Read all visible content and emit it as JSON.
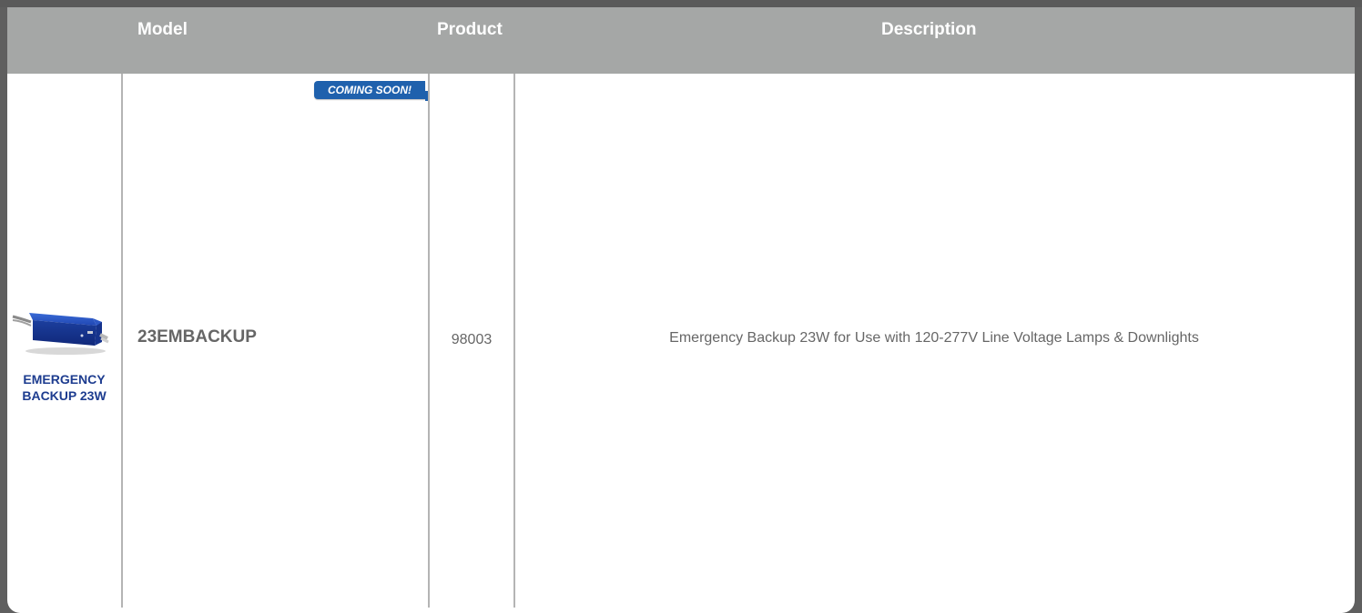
{
  "table": {
    "headers": {
      "model": "Model",
      "product": "Product",
      "description": "Description"
    },
    "rows": [
      {
        "image_label_line1": "EMERGENCY",
        "image_label_line2": "BACKUP 23W",
        "badge": "COMING SOON!",
        "model": "23EMBACKUP",
        "product": "98003",
        "description": "Emergency Backup 23W for Use with 120-277V Line Voltage Lamps & Downlights"
      }
    ]
  },
  "colors": {
    "header_bg": "#a5a7a6",
    "frame_bg": "#5f5f5f",
    "badge_bg": "#1f61ad",
    "label_blue": "#1d3c8f",
    "body_text": "#666666"
  },
  "icons": {
    "product_image": "emergency-backup-module-photo"
  }
}
